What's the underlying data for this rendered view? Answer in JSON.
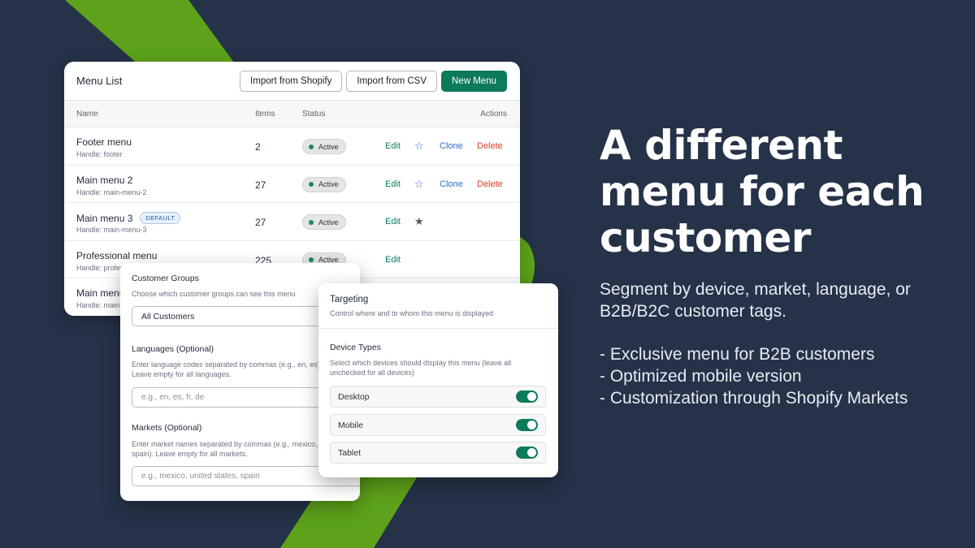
{
  "colors": {
    "background": "#253248",
    "accent_green": "#5da21a",
    "primary_button": "#0d7a5c"
  },
  "menu_list": {
    "title": "Menu List",
    "buttons": {
      "import_shopify": "Import from Shopify",
      "import_csv": "Import from CSV",
      "new_menu": "New Menu"
    },
    "columns": {
      "name": "Name",
      "items": "Items",
      "status": "Status",
      "actions": "Actions"
    },
    "rows": [
      {
        "name": "Footer menu",
        "handle": "Handle: footer",
        "items": "2",
        "status": "Active",
        "edit": "Edit",
        "clone": "Clone",
        "delete": "Delete",
        "star": "☆"
      },
      {
        "name": "Main menu 2",
        "handle": "Handle: main-menu-2",
        "items": "27",
        "status": "Active",
        "edit": "Edit",
        "clone": "Clone",
        "delete": "Delete",
        "star": "☆"
      },
      {
        "name": "Main menu 3",
        "badge": "DEFAULT",
        "handle": "Handle: main-menu-3",
        "items": "27",
        "status": "Active",
        "edit": "Edit",
        "star": "★"
      },
      {
        "name": "Professional menu",
        "handle": "Handle: profes",
        "items": "225",
        "status": "Active",
        "edit": "Edit"
      },
      {
        "name": "Main menu",
        "handle": "Handle: main-n"
      }
    ]
  },
  "customer_groups": {
    "label": "Customer Groups",
    "description": "Choose which customer groups can see this menu",
    "value": "All Customers",
    "languages_label": "Languages (Optional)",
    "languages_desc": "Enter language codes separated by commas (e.g., en, es). Leave empty for all languages.",
    "languages_placeholder": "e.g., en, es, fr, de",
    "markets_label": "Markets (Optional)",
    "markets_desc": "Enter market names separated by commas (e.g., mexico, spain). Leave empty for all markets.",
    "markets_placeholder": "e.g., mexico, united states, spain"
  },
  "targeting": {
    "title": "Targeting",
    "subtitle": "Control where and to whom this menu is displayed",
    "device_title": "Device Types",
    "device_desc": "Select which devices should display this menu (leave all unchecked for all devices)",
    "devices": [
      {
        "name": "Desktop",
        "enabled": true
      },
      {
        "name": "Mobile",
        "enabled": true
      },
      {
        "name": "Tablet",
        "enabled": true
      }
    ]
  },
  "promo": {
    "headline": "A different menu for each customer",
    "subtext": "Segment by device, market, language, or B2B/B2C customer tags.",
    "bullets": [
      "- Exclusive menu for B2B customers",
      "- Optimized mobile version",
      "- Customization through Shopify Markets"
    ]
  }
}
